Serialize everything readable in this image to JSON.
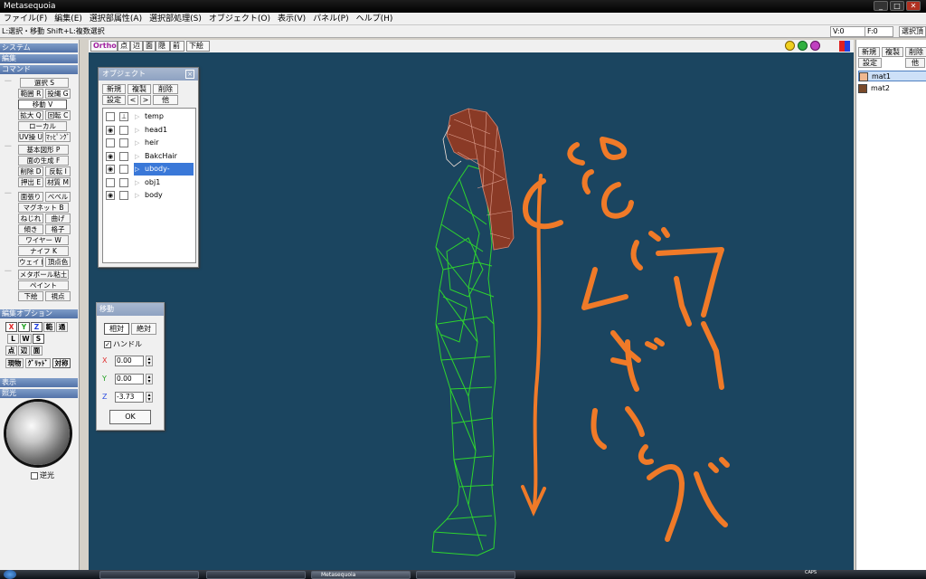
{
  "window": {
    "title": "Metasequoia",
    "min": "_",
    "max": "□",
    "close": "✕"
  },
  "menu": [
    "ファイル(F)",
    "編集(E)",
    "選択部属性(A)",
    "選択部処理(S)",
    "オブジェクト(O)",
    "表示(V)",
    "パネル(P)",
    "ヘルプ(H)"
  ],
  "status": {
    "hint": "L:選択・移動  Shift+L:複数選択",
    "v": "V:0",
    "f": "F:0",
    "sel": "選択頂"
  },
  "left": {
    "sections": {
      "system": "システム",
      "edit": "編集",
      "command": "コマンド",
      "edit_option": "編集オプション",
      "display": "表示",
      "lighting": "照光"
    },
    "cmd1": [
      {
        "label": "選択 S",
        "active": false
      },
      {
        "label": "範囲 R",
        "active": false
      },
      {
        "label": "投縄 G",
        "active": false
      },
      {
        "label": "移動 V",
        "active": true
      },
      {
        "label": "拡大 Q",
        "active": false
      },
      {
        "label": "回転 C",
        "active": false
      },
      {
        "label": "ローカル",
        "active": false
      },
      {
        "label": "UV操 U",
        "active": false
      },
      {
        "label": "ﾏｯﾋﾟﾝｸﾞ",
        "active": false
      }
    ],
    "cmd2": [
      "基本図形 P",
      "面の生成 F",
      "削除 D",
      "反転 I",
      "押出 E",
      "材質 M"
    ],
    "cmd3": [
      "面張り",
      "ベベル",
      "マグネット B",
      "ねじれ",
      "曲げ",
      "傾き",
      "格子",
      "ワイヤー W",
      "ナイフ K",
      "ウェイト",
      "頂点色"
    ],
    "cmd4": [
      "メタボール粘土",
      "ペイント",
      "下絵",
      "視点"
    ],
    "opts1": [
      "X",
      "Y",
      "Z",
      "範",
      "通"
    ],
    "opts2": [
      "L",
      "W",
      "S"
    ],
    "opts3": [
      "点",
      "辺",
      "面"
    ],
    "opts4": [
      "現物",
      "ｸﾞﾘｯﾄﾞ",
      "対称"
    ],
    "backlight": "逆光",
    "backlight_checked": false
  },
  "viewtb": {
    "buttons": [
      "Ortho",
      "点",
      "辺",
      "面",
      "隠",
      "前",
      "下絵"
    ]
  },
  "objwin": {
    "title": "オブジェクト",
    "btns1": [
      "新規",
      "複製",
      "削除"
    ],
    "btns2": [
      "設定",
      "<",
      ">",
      "他"
    ],
    "items": [
      {
        "name": "temp",
        "visible": false,
        "locked": true,
        "selected": false
      },
      {
        "name": "head1",
        "visible": true,
        "locked": false,
        "selected": false
      },
      {
        "name": "heir",
        "visible": false,
        "locked": false,
        "selected": false
      },
      {
        "name": "BakcHair",
        "visible": true,
        "locked": false,
        "selected": false
      },
      {
        "name": "ubody-",
        "visible": true,
        "locked": false,
        "selected": true
      },
      {
        "name": "obj1",
        "visible": false,
        "locked": false,
        "selected": false
      },
      {
        "name": "body",
        "visible": true,
        "locked": false,
        "selected": false
      }
    ]
  },
  "movewin": {
    "title": "移動",
    "relative": "相対",
    "absolute": "絶対",
    "handle": "ハンドル",
    "handle_checked": true,
    "x": "0.00",
    "y": "0.00",
    "z": "-3.73",
    "ok": "OK"
  },
  "right": {
    "btns": [
      "新規",
      "複製",
      "削除"
    ],
    "btns2": [
      "設定",
      "他"
    ],
    "materials": [
      {
        "name": "mat1",
        "color": "#f0b890",
        "selected": true
      },
      {
        "name": "mat2",
        "color": "#7a4a2a",
        "selected": false
      }
    ]
  },
  "annotation": {
    "color": "#f07a28"
  },
  "taskbar": {
    "app": "Metasequoia",
    "caps": "CAPS"
  }
}
